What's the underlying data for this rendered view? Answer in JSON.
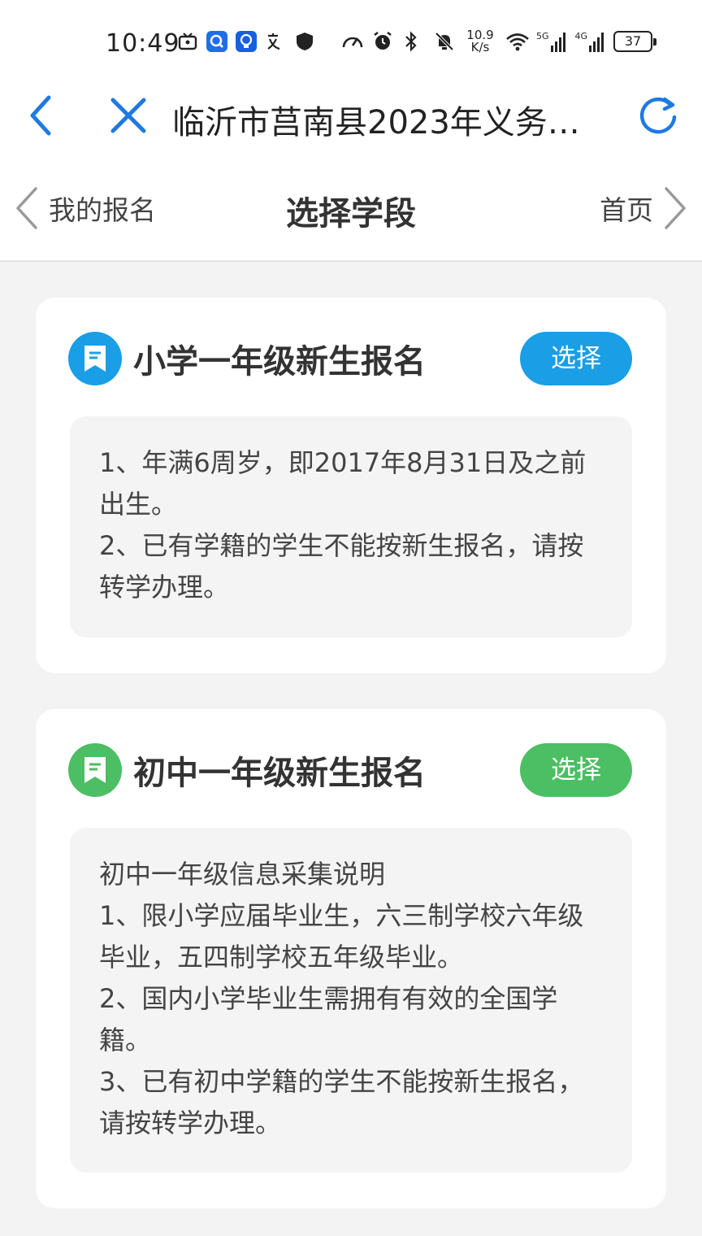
{
  "status_bar": {
    "time": "10:49",
    "network_speed_value": "10.9",
    "network_speed_unit": "K/s",
    "sim1_type": "5G",
    "sim2_type": "4G",
    "battery_level": "37"
  },
  "browser": {
    "page_title": "临沂市莒南县2023年义务…",
    "back_icon": "chevron-left-icon",
    "close_icon": "close-icon",
    "refresh_icon": "refresh-icon",
    "accent_color": "#1e7ae0"
  },
  "header": {
    "back_label": "我的报名",
    "title": "选择学段",
    "home_label": "首页"
  },
  "cards": [
    {
      "title": "小学一年级新生报名",
      "button_label": "选择",
      "color": "#1a9ee6",
      "icon": "document-bookmark-icon",
      "lines": [
        "1、年满6周岁，即2017年8月31日及之前出生。",
        "2、已有学籍的学生不能按新生报名，请按转学办理。"
      ]
    },
    {
      "title": "初中一年级新生报名",
      "button_label": "选择",
      "color": "#4cbe64",
      "icon": "document-bookmark-icon",
      "lines": [
        "初中一年级信息采集说明",
        "1、限小学应届毕业生，六三制学校六年级毕业，五四制学校五年级毕业。",
        "2、国内小学毕业生需拥有有效的全国学籍。",
        "3、已有初中学籍的学生不能按新生报名，请按转学办理。"
      ]
    }
  ]
}
